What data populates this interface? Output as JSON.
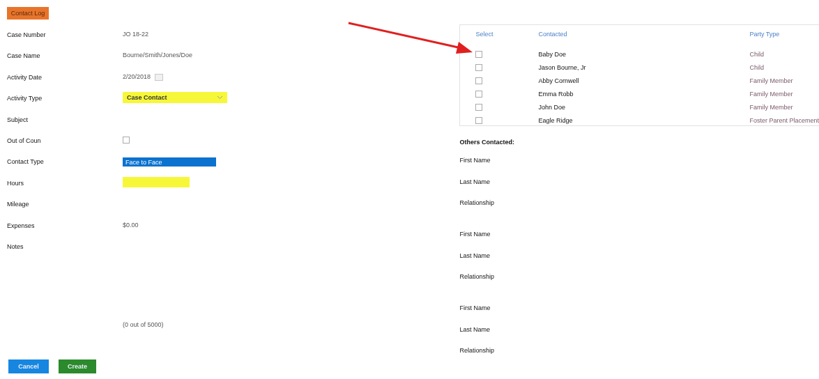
{
  "tab": {
    "label": "Contact Log",
    "selected": true
  },
  "fields": [
    {
      "label": "Case Number",
      "kind": "text",
      "value": "JO 18-22"
    },
    {
      "label": "Case Name",
      "kind": "text",
      "value": "Bourne/Smith/Jones/Doe"
    },
    {
      "label": "Activity Date",
      "kind": "date",
      "value": "2/20/2018"
    },
    {
      "label": "Activity Type",
      "kind": "select",
      "value": "Case Contact"
    },
    {
      "label": "Subject",
      "kind": "empty"
    },
    {
      "label": "Out of Coun",
      "kind": "checkbox",
      "checked": false
    },
    {
      "label": "Contact Type",
      "kind": "option",
      "value": "Face to Face"
    },
    {
      "label": "Hours",
      "kind": "input"
    },
    {
      "label": "Mileage",
      "kind": "empty"
    },
    {
      "label": "Expenses",
      "kind": "text",
      "value": "$0.00"
    },
    {
      "label": "Notes",
      "kind": "notes",
      "counter": "(0 out of 5000)"
    }
  ],
  "buttons": [
    {
      "label": "Cancel",
      "kind": "cancel"
    },
    {
      "label": "Create",
      "kind": "create"
    }
  ],
  "table": {
    "columns": [
      "Select",
      "Contacted",
      "Party Type"
    ],
    "rows": [
      {
        "checked": false,
        "contacted": "Baby Doe",
        "party_type": "Child"
      },
      {
        "checked": false,
        "contacted": "Jason Bourne, Jr",
        "party_type": "Child"
      },
      {
        "checked": false,
        "contacted": "Abby Cornwell",
        "party_type": "Family Member"
      },
      {
        "checked": false,
        "contacted": "Emma Robb",
        "party_type": "Family Member"
      },
      {
        "checked": false,
        "contacted": "John Doe",
        "party_type": "Family Member"
      },
      {
        "checked": false,
        "contacted": "Eagle Ridge",
        "party_type": "Foster Parent Placement"
      }
    ]
  },
  "others": {
    "title": "Others Contacted:",
    "groups": [
      [
        "First Name",
        "Last Name",
        "Relationship"
      ],
      [
        "First Name",
        "Last Name",
        "Relationship"
      ],
      [
        "First Name",
        "Last Name",
        "Relationship"
      ]
    ]
  }
}
